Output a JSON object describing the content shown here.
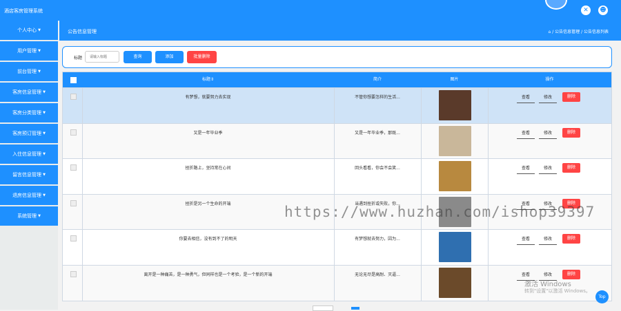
{
  "app": {
    "title": "酒店客房管理系统"
  },
  "topbar_icons": [
    "close-x-icon",
    "user-icon"
  ],
  "sidebar": {
    "items": [
      {
        "label": "个人中心"
      },
      {
        "label": "用户管理"
      },
      {
        "label": "前台管理"
      },
      {
        "label": "客房信息管理"
      },
      {
        "label": "客房分类管理"
      },
      {
        "label": "客房预订管理"
      },
      {
        "label": "入住信息管理"
      },
      {
        "label": "留言信息管理"
      },
      {
        "label": "退房信息管理"
      },
      {
        "label": "系统管理"
      }
    ]
  },
  "header": {
    "title": "公告信息管理",
    "breadcrumb": "⌂ / 公告信息管理 / 公告信息列表"
  },
  "search": {
    "label": "标题",
    "placeholder": "请输入标题",
    "query_label": "查询",
    "add_label": "添加",
    "batch_delete_label": "批量删除"
  },
  "table": {
    "headers": {
      "title": "标题⇕",
      "summary": "简介",
      "image": "图片",
      "actions": "操作"
    },
    "action_labels": {
      "view": "查看",
      "edit": "修改",
      "delete": "删除"
    },
    "rows": [
      {
        "title": "有梦想，就要努力去实现",
        "summary": "不管你想要怎样的生活...",
        "image_color": "#5a3a2a"
      },
      {
        "title": "又是一年毕业季",
        "summary": "又是一年毕业季，那既...",
        "image_color": "#c9b79a"
      },
      {
        "title": "挫折路上，坚持常在心间",
        "summary": "回头看看，你会不会笑...",
        "image_color": "#b8893f"
      },
      {
        "title": "挫折是另一个生命的开端",
        "summary": "当遇到挫折或失败，你...",
        "image_color": "#8a8a8a"
      },
      {
        "title": "你要去相信，没有到不了的明天",
        "summary": "有梦想就去努力，因为...",
        "image_color": "#2f6fb0"
      },
      {
        "title": "离开是一种痛苦，是一种勇气，但同样也是一个考验，是一个新的开端",
        "summary": "无论无尽是高耐、灭逼...",
        "image_color": "#6b4a2a"
      }
    ]
  },
  "watermark": "https://www.huzhan.com/ishop39397",
  "windows_activation": {
    "line1": "激活 Windows",
    "line2": "转到\"设置\"以激活 Windows。"
  },
  "back_to_top": "Top",
  "colors": {
    "primary": "#1e90ff",
    "danger": "#ff4444",
    "selected_row": "#cfe3f7"
  }
}
